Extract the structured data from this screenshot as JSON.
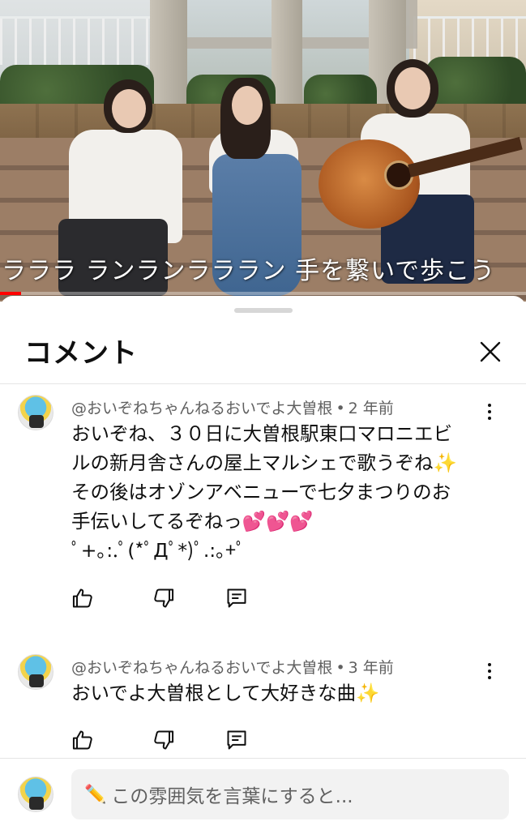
{
  "video": {
    "caption": "ラララ ランランラララン 手を繋いで歩こう",
    "progress": 0.04,
    "progress_color": "#ff0000"
  },
  "sheet": {
    "title": "コメント",
    "close_icon": "close-icon"
  },
  "comments": [
    {
      "author": "@おいぞねちゃんねるおいでよ大曽根",
      "time": "2 年前",
      "lines": [
        "おいぞね、３０日に大曽根駅東口マロニエビ",
        "ルの新月舎さんの屋上マルシェで歌うぞね✨",
        "その後はオゾンアベニューで七夕まつりのお",
        "手伝いしてるぞねっ💕💕💕",
        "ﾟ+｡:.ﾟ(*ﾟДﾟ*)ﾟ.:｡+ﾟ"
      ]
    },
    {
      "author": "@おいぞねちゃんねるおいでよ大曽根",
      "time": "3 年前",
      "lines": [
        "おいでよ大曽根として大好きな曲✨"
      ]
    }
  ],
  "actions": {
    "like_icon": "thumbs-up-icon",
    "dislike_icon": "thumbs-down-icon",
    "reply_icon": "reply-icon",
    "menu_icon": "more-vert-icon"
  },
  "composer": {
    "pencil": "✏️",
    "placeholder": "この雰囲気を言葉にすると..."
  }
}
